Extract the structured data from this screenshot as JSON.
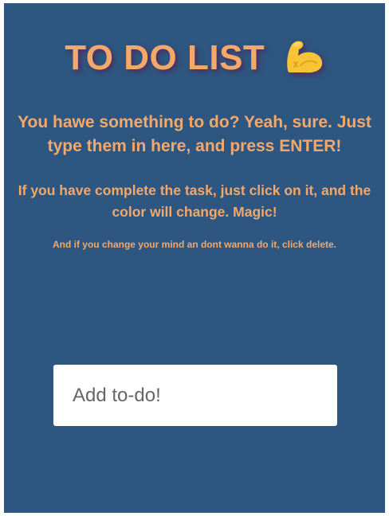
{
  "header": {
    "title": "TO DO LIST",
    "emoji_icon": "flexed-biceps-icon"
  },
  "instructions": {
    "intro": "You hawe something to do? Yeah, sure. Just type them in here, and press ENTER!",
    "complete": "If you have complete the task, just click on it, and the color will change. Magic!",
    "delete": "And if you change your mind an dont wanna do it, click delete."
  },
  "todo_input": {
    "placeholder": "Add to-do!",
    "value": ""
  },
  "colors": {
    "background": "#2d5781",
    "accent_text": "#f4a86a",
    "text_shadow": "#5a1e50",
    "input_background": "#ffffff",
    "page_border": "#ffffff"
  }
}
